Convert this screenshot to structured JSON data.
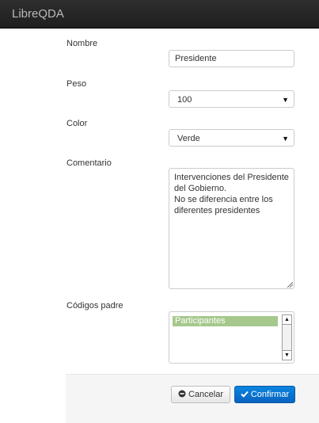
{
  "app": {
    "title": "LibreQDA"
  },
  "form": {
    "nombre": {
      "label": "Nombre",
      "value": "Presidente"
    },
    "peso": {
      "label": "Peso",
      "selected": "100"
    },
    "color": {
      "label": "Color",
      "selected": "Verde"
    },
    "comentario": {
      "label": "Comentario",
      "lines": [
        "Intervenciones del Presidente",
        "del Gobierno.",
        "No se diferencia entre los",
        "diferentes presidentes"
      ]
    },
    "codigos_padre": {
      "label": "Códigos padre",
      "options": [
        "Participantes"
      ],
      "selected_color": "#a6c88c"
    }
  },
  "actions": {
    "cancel_label": "Cancelar",
    "confirm_label": "Confirmar",
    "cancel_icon": "circle-minus-icon",
    "confirm_icon": "check-icon",
    "confirm_color": "#0a6fd0"
  }
}
